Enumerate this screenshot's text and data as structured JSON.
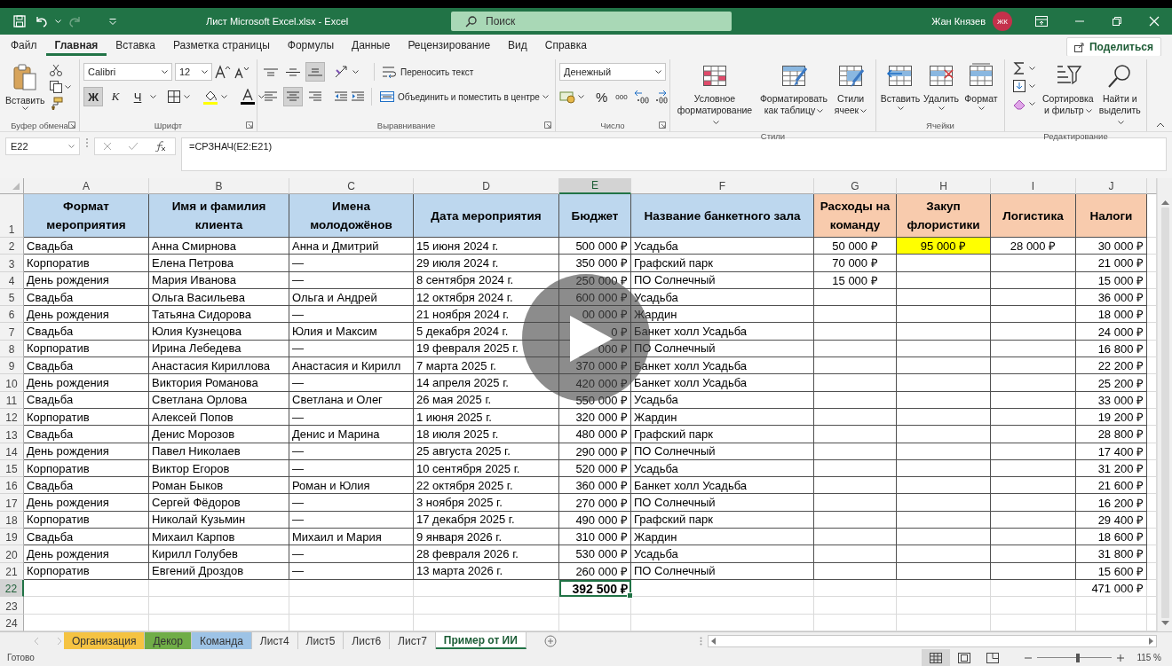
{
  "title_bar": {
    "title": "Лист Microsoft Excel.xlsx  -  Excel",
    "search": {
      "placeholder": "Поиск"
    },
    "user_name": "Жан Князев",
    "avatar_initials": "ЖК"
  },
  "menu_tabs": [
    {
      "label": "Файл",
      "selected": false
    },
    {
      "label": "Главная",
      "selected": true
    },
    {
      "label": "Вставка",
      "selected": false
    },
    {
      "label": "Разметка страницы",
      "selected": false
    },
    {
      "label": "Формулы",
      "selected": false
    },
    {
      "label": "Данные",
      "selected": false
    },
    {
      "label": "Рецензирование",
      "selected": false
    },
    {
      "label": "Вид",
      "selected": false
    },
    {
      "label": "Справка",
      "selected": false
    }
  ],
  "share_button": "Поделиться",
  "ribbon": {
    "clipboard": {
      "paste_label": "Вставить",
      "group_label": "Буфер обмена"
    },
    "font": {
      "font_name": "Calibri",
      "font_size": "12",
      "group_label": "Шрифт",
      "style_buttons": [
        {
          "label": "Ж",
          "kind": "bold",
          "pressed": true
        },
        {
          "label": "К",
          "kind": "italic",
          "pressed": false
        },
        {
          "label": "Ч",
          "kind": "underline",
          "pressed": false
        }
      ]
    },
    "alignment": {
      "group_label": "Выравнивание",
      "wrap_label": "Переносить текст",
      "merge_label": "Объединить и поместить в центре",
      "buttons": [
        {
          "kind": "top",
          "pressed": false
        },
        {
          "kind": "middle",
          "pressed": false
        },
        {
          "kind": "bottom",
          "pressed": true
        },
        {
          "kind": "left",
          "pressed": false
        },
        {
          "kind": "center",
          "pressed": true
        },
        {
          "kind": "right",
          "pressed": false
        }
      ]
    },
    "number": {
      "format": "Денежный",
      "percent_label": "%",
      "thousands_label": "000",
      "group_label": "Число"
    },
    "styles": {
      "group_label": "Стили",
      "buttons": [
        {
          "label": "Условное форматирование",
          "kind": "conditional"
        },
        {
          "label": "Форматировать как таблицу",
          "kind": "table"
        },
        {
          "label": "Стили ячеек",
          "kind": "cell"
        }
      ]
    },
    "cells": {
      "group_label": "Ячейки",
      "buttons": [
        {
          "label": "Вставить",
          "kind": "insert"
        },
        {
          "label": "Удалить",
          "kind": "delete"
        },
        {
          "label": "Формат",
          "kind": "format"
        }
      ]
    },
    "editing": {
      "group_label": "Редактирование",
      "buttons": [
        {
          "label": "Сортировка и фильтр",
          "kind": "sort"
        },
        {
          "label": "Найти и выделить",
          "kind": "find"
        }
      ]
    }
  },
  "formula_bar": {
    "cell_reference": "E22",
    "formula": "=СРЗНАЧ(E2:E21)"
  },
  "sheet": {
    "columns": [
      {
        "label": "A",
        "selected": false
      },
      {
        "label": "B",
        "selected": false
      },
      {
        "label": "C",
        "selected": false
      },
      {
        "label": "D",
        "selected": false
      },
      {
        "label": "E",
        "selected": true
      },
      {
        "label": "F",
        "selected": false
      },
      {
        "label": "G",
        "selected": false
      },
      {
        "label": "H",
        "selected": false
      },
      {
        "label": "I",
        "selected": false
      },
      {
        "label": "J",
        "selected": false
      }
    ],
    "header": {
      "number": "1",
      "cells": [
        {
          "text": "Формат мероприятия",
          "color": "#bdd7ee"
        },
        {
          "text": "Имя и фамилия клиента",
          "color": "#bdd7ee"
        },
        {
          "text": "Имена молодожёнов",
          "color": "#bdd7ee"
        },
        {
          "text": "Дата мероприятия",
          "color": "#bdd7ee"
        },
        {
          "text": "Бюджет",
          "color": "#bdd7ee"
        },
        {
          "text": "Название банкетного зала",
          "color": "#bdd7ee"
        },
        {
          "text": "Расходы на команду",
          "color": "#f8cbad"
        },
        {
          "text": "Закуп флористики",
          "color": "#f8cbad"
        },
        {
          "text": "Логистика",
          "color": "#f8cbad"
        },
        {
          "text": "Налоги",
          "color": "#f8cbad"
        }
      ]
    },
    "rows": [
      {
        "number": "2",
        "selected": false,
        "cells": {
          "A": "Свадьба",
          "B": "Анна Смирнова",
          "C": "Анна и Дмитрий",
          "D": "15 июня 2024 г.",
          "E": "500 000 ₽",
          "F": "Усадьба",
          "G": "50 000 ₽",
          "H": {
            "text": "95 000 ₽",
            "color": "#ffff00"
          },
          "I": "28 000 ₽",
          "J": "30 000 ₽"
        }
      },
      {
        "number": "3",
        "selected": false,
        "cells": {
          "A": "Корпоратив",
          "B": "Елена Петрова",
          "C": "—",
          "D": "29 июля 2024 г.",
          "E": "350 000 ₽",
          "F": "Графский парк",
          "G": "70 000 ₽",
          "J": "21 000 ₽"
        }
      },
      {
        "number": "4",
        "selected": false,
        "cells": {
          "A": "День рождения",
          "B": "Мария Иванова",
          "C": "—",
          "D": "8 сентября 2024 г.",
          "E": "250 000 ₽",
          "F": "ПО Солнечный",
          "G": "15 000 ₽",
          "J": "15 000 ₽"
        }
      },
      {
        "number": "5",
        "selected": false,
        "cells": {
          "A": "Свадьба",
          "B": "Ольга Васильева",
          "C": "Ольга и Андрей",
          "D": "12 октября 2024 г.",
          "E": "600 000 ₽",
          "F": "Усадьба",
          "J": "36 000 ₽"
        }
      },
      {
        "number": "6",
        "selected": false,
        "cells": {
          "A": "День рождения",
          "B": "Татьяна Сидорова",
          "C": "—",
          "D": "21 ноября 2024 г.",
          "E": "00 000 ₽",
          "F": "Жардин",
          "J": "18 000 ₽"
        }
      },
      {
        "number": "7",
        "selected": false,
        "cells": {
          "A": "Свадьба",
          "B": "Юлия Кузнецова",
          "C": "Юлия и Максим",
          "D": "5 декабря 2024 г.",
          "E": "0 ₽",
          "F": "Банкет холл Усадьба",
          "J": "24 000 ₽"
        }
      },
      {
        "number": "8",
        "selected": false,
        "cells": {
          "A": "Корпоратив",
          "B": "Ирина Лебедева",
          "C": "—",
          "D": "19 февраля 2025 г.",
          "E": "000 ₽",
          "F": "ПО Солнечный",
          "J": "16 800 ₽"
        }
      },
      {
        "number": "9",
        "selected": false,
        "cells": {
          "A": "Свадьба",
          "B": "Анастасия Кириллова",
          "C": "Анастасия и Кирилл",
          "D": "7 марта 2025 г.",
          "E": "370 000 ₽",
          "F": "Банкет холл Усадьба",
          "J": "22 200 ₽"
        }
      },
      {
        "number": "10",
        "selected": false,
        "cells": {
          "A": "День рождения",
          "B": "Виктория Романова",
          "C": "—",
          "D": "14 апреля 2025 г.",
          "E": "420 000 ₽",
          "F": "Банкет холл Усадьба",
          "J": "25 200 ₽"
        }
      },
      {
        "number": "11",
        "selected": false,
        "cells": {
          "A": "Свадьба",
          "B": "Светлана Орлова",
          "C": "Светлана и Олег",
          "D": "26 мая 2025 г.",
          "E": "550 000 ₽",
          "F": "Усадьба",
          "J": "33 000 ₽"
        }
      },
      {
        "number": "12",
        "selected": false,
        "cells": {
          "A": "Корпоратив",
          "B": "Алексей Попов",
          "C": "—",
          "D": "1 июня 2025 г.",
          "E": "320 000 ₽",
          "F": "Жардин",
          "J": "19 200 ₽"
        }
      },
      {
        "number": "13",
        "selected": false,
        "cells": {
          "A": "Свадьба",
          "B": "Денис Морозов",
          "C": "Денис и Марина",
          "D": "18 июля 2025 г.",
          "E": "480 000 ₽",
          "F": "Графский парк",
          "J": "28 800 ₽"
        }
      },
      {
        "number": "14",
        "selected": false,
        "cells": {
          "A": "День рождения",
          "B": "Павел Николаев",
          "C": "—",
          "D": "25 августа 2025 г.",
          "E": "290 000 ₽",
          "F": "ПО Солнечный",
          "J": "17 400 ₽"
        }
      },
      {
        "number": "15",
        "selected": false,
        "cells": {
          "A": "Корпоратив",
          "B": "Виктор Егоров",
          "C": "—",
          "D": "10 сентября 2025 г.",
          "E": "520 000 ₽",
          "F": "Усадьба",
          "J": "31 200 ₽"
        }
      },
      {
        "number": "16",
        "selected": false,
        "cells": {
          "A": "Свадьба",
          "B": "Роман Быков",
          "C": "Роман и Юлия",
          "D": "22 октября 2025 г.",
          "E": "360 000 ₽",
          "F": "Банкет холл Усадьба",
          "J": "21 600 ₽"
        }
      },
      {
        "number": "17",
        "selected": false,
        "cells": {
          "A": "День рождения",
          "B": "Сергей Фёдоров",
          "C": "—",
          "D": "3 ноября 2025 г.",
          "E": "270 000 ₽",
          "F": "ПО Солнечный",
          "J": "16 200 ₽"
        }
      },
      {
        "number": "18",
        "selected": false,
        "cells": {
          "A": "Корпоратив",
          "B": "Николай Кузьмин",
          "C": "—",
          "D": "17 декабря 2025 г.",
          "E": "490 000 ₽",
          "F": "Графский парк",
          "J": "29 400 ₽"
        }
      },
      {
        "number": "19",
        "selected": false,
        "cells": {
          "A": "Свадьба",
          "B": "Михаил Карпов",
          "C": "Михаил и Мария",
          "D": "9 января 2026 г.",
          "E": "310 000 ₽",
          "F": "Жардин",
          "J": "18 600 ₽"
        }
      },
      {
        "number": "20",
        "selected": false,
        "cells": {
          "A": "День рождения",
          "B": "Кирилл Голубев",
          "C": "—",
          "D": "28 февраля 2026 г.",
          "E": "530 000 ₽",
          "F": "Усадьба",
          "J": "31 800 ₽"
        }
      },
      {
        "number": "21",
        "selected": false,
        "cells": {
          "A": "Корпоратив",
          "B": "Евгений Дроздов",
          "C": "—",
          "D": "13 марта 2026 г.",
          "E": "260 000 ₽",
          "F": "ПО Солнечный",
          "J": "15 600 ₽"
        }
      },
      {
        "number": "22",
        "selected": true,
        "cells": {
          "E": {
            "text": "392 500 ₽",
            "bold": true,
            "selected": true
          },
          "J": "471 000 ₽"
        }
      },
      {
        "number": "23",
        "selected": false,
        "cells": {}
      },
      {
        "number": "24",
        "selected": false,
        "cells": {}
      }
    ]
  },
  "sheet_tabs": [
    {
      "label": "Организация",
      "color": "#f5c342",
      "selected": false
    },
    {
      "label": "Декор",
      "color": "#70ad47",
      "selected": false
    },
    {
      "label": "Команда",
      "color": "#9dc3e6",
      "selected": false
    },
    {
      "label": "Лист4",
      "selected": false
    },
    {
      "label": "Лист5",
      "selected": false
    },
    {
      "label": "Лист6",
      "selected": false
    },
    {
      "label": "Лист7",
      "selected": false
    },
    {
      "label": "Пример от ИИ",
      "selected": true
    }
  ],
  "status_bar": {
    "status": "Готово",
    "zoom_text": "115 %",
    "zoom": {
      "level": 0.54
    }
  }
}
